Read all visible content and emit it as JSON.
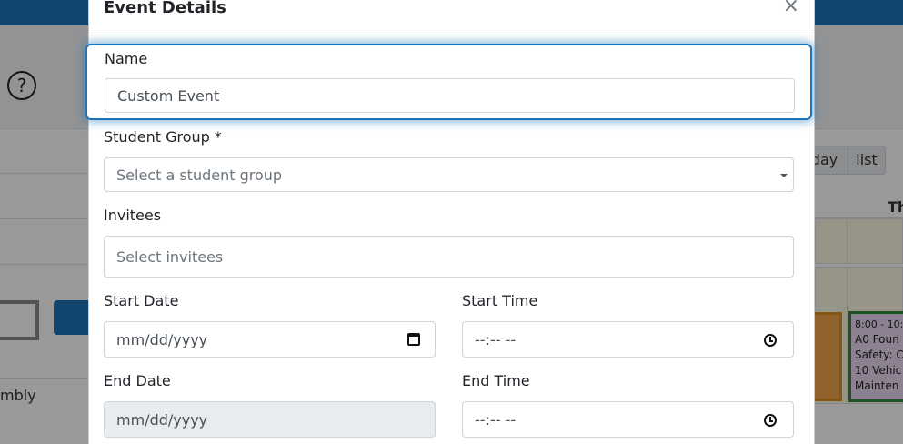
{
  "background": {
    "help_icon": "?",
    "partial_text": "mbly",
    "calendar": {
      "day_button": "day",
      "list_button": "list",
      "column_header": "Th",
      "event_text": [
        "8:00 - 10:0",
        "A0 Foun",
        "Safety: C",
        "10 Vehic",
        "Mainten"
      ]
    }
  },
  "modal": {
    "title": "Event Details",
    "close_icon": "×",
    "name": {
      "label": "Name",
      "value": "Custom Event"
    },
    "student_group": {
      "label": "Student Group *",
      "placeholder": "Select a student group"
    },
    "invitees": {
      "label": "Invitees",
      "placeholder": "Select invitees"
    },
    "start_date": {
      "label": "Start Date",
      "placeholder": "mm/dd/yyyy"
    },
    "start_time": {
      "label": "Start Time",
      "placeholder": "--:-- --"
    },
    "end_date": {
      "label": "End Date",
      "placeholder": "mm/dd/yyyy"
    },
    "end_time": {
      "label": "End Time",
      "placeholder": "--:-- --"
    }
  },
  "colors": {
    "primary": "#1f74b8",
    "event_orange": "#f0a44b",
    "event_green_border": "#2e8b3d"
  }
}
